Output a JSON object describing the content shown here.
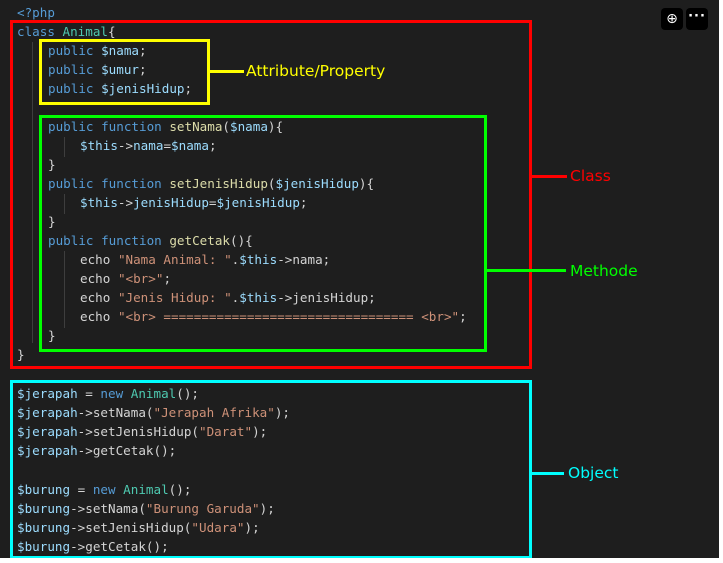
{
  "code": {
    "php_open": "<?php",
    "class_line": {
      "kw": "class",
      "name": "Animal",
      "brace": "{"
    },
    "properties": [
      {
        "kw": "public",
        "var": "$nama",
        "end": ";"
      },
      {
        "kw": "public",
        "var": "$umur",
        "end": ";"
      },
      {
        "kw": "public",
        "var": "$jenisHidup",
        "end": ";"
      }
    ],
    "methods": {
      "set_nama": {
        "kw": "public function",
        "name": "setNama",
        "open": "(",
        "param": "$nama",
        "close": "){",
        "body_this": "$this",
        "body_arrow": "->",
        "body_prop": "nama",
        "body_eq": "=",
        "body_val": "$nama",
        "body_end": ";",
        "close_brace": "}"
      },
      "set_jenis": {
        "kw": "public function",
        "name": "setJenisHidup",
        "open": "(",
        "param": "$jenisHidup",
        "close": "){",
        "body_this": "$this",
        "body_arrow": "->",
        "body_prop": "jenisHidup",
        "body_eq": "=",
        "body_val": "$jenisHidup",
        "body_end": ";",
        "close_brace": "}"
      },
      "get_cetak": {
        "kw": "public function",
        "name": "getCetak",
        "sig_rest": "(){",
        "echo_kw": "echo",
        "echo1_str": "\"Nama Animal: \"",
        "echo1_dot": ".",
        "echo1_this": "$this",
        "echo1_rest": "->nama;",
        "echo2_str": "\"<br>\"",
        "echo2_end": ";",
        "echo3_str": "\"Jenis Hidup: \"",
        "echo3_dot": ".",
        "echo3_this": "$this",
        "echo3_rest": "->jenisHidup;",
        "echo4_str": "\"<br> ================================= <br>\"",
        "echo4_end": ";",
        "close_brace": "}"
      }
    },
    "class_close": "}",
    "objects": {
      "jerapah_new_var": "$jerapah",
      "jerapah_new_eq": " = ",
      "jerapah_new_kw": "new",
      "jerapah_new_cls": "Animal",
      "jerapah_new_end": "();",
      "jerapah_var": "$jerapah",
      "set_nama_call": "->setNama(",
      "set_nama_arg_j": "\"Jerapah Afrika\"",
      "call_end": ");",
      "set_jenis_call": "->setJenisHidup(",
      "set_jenis_arg_j": "\"Darat\"",
      "get_cetak_call": "->getCetak();",
      "burung_new_var": "$burung",
      "burung_new_kw": "new",
      "burung_new_cls": "Animal",
      "burung_var": "$burung",
      "set_nama_arg_b": "\"Burung Garuda\"",
      "set_jenis_arg_b": "\"Udara\""
    }
  },
  "annotations": {
    "property": "Attribute/Property",
    "class": "Class",
    "method": "Methode",
    "object": "Object"
  },
  "toolbar": {
    "download_icon": "download-icon",
    "more_icon": "more-options-icon",
    "download_glyph": "⊕",
    "more_glyph": "···"
  },
  "colors": {
    "background": "#1e1e1e",
    "class_box": "#ff0000",
    "property_box": "#ffff00",
    "method_box": "#00ff00",
    "object_box": "#00ffff"
  }
}
